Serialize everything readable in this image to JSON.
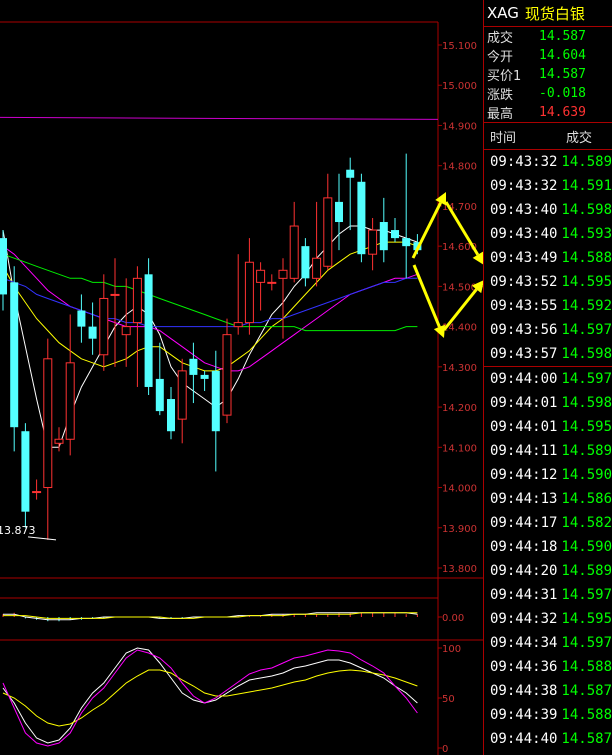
{
  "quote": {
    "code": "XAG",
    "name": "现货白银",
    "rows": [
      {
        "label": "成交",
        "value": "14.587",
        "color": "#00ff00"
      },
      {
        "label": "今开",
        "value": "14.604",
        "color": "#00ff00"
      },
      {
        "label": "买价1",
        "value": "14.587",
        "color": "#00ff00"
      },
      {
        "label": "涨跌",
        "value": "-0.018",
        "color": "#00ff00"
      },
      {
        "label": "最高",
        "value": "14.639",
        "color": "#ff3232"
      }
    ]
  },
  "trades": {
    "header_time": "时间",
    "header_price": "成交",
    "items": [
      {
        "time": "09:43:32",
        "price": "14.589"
      },
      {
        "time": "09:43:32",
        "price": "14.591"
      },
      {
        "time": "09:43:40",
        "price": "14.598"
      },
      {
        "time": "09:43:40",
        "price": "14.593"
      },
      {
        "time": "09:43:49",
        "price": "14.588"
      },
      {
        "time": "09:43:52",
        "price": "14.595"
      },
      {
        "time": "09:43:55",
        "price": "14.592"
      },
      {
        "time": "09:43:56",
        "price": "14.597"
      },
      {
        "time": "09:43:57",
        "price": "14.598"
      },
      {
        "time": "09:44:00",
        "price": "14.597"
      },
      {
        "time": "09:44:01",
        "price": "14.598"
      },
      {
        "time": "09:44:01",
        "price": "14.595"
      },
      {
        "time": "09:44:11",
        "price": "14.589"
      },
      {
        "time": "09:44:12",
        "price": "14.590"
      },
      {
        "time": "09:44:13",
        "price": "14.586"
      },
      {
        "time": "09:44:17",
        "price": "14.582"
      },
      {
        "time": "09:44:18",
        "price": "14.590"
      },
      {
        "time": "09:44:20",
        "price": "14.589"
      },
      {
        "time": "09:44:31",
        "price": "14.597"
      },
      {
        "time": "09:44:32",
        "price": "14.595"
      },
      {
        "time": "09:44:34",
        "price": "14.597"
      },
      {
        "time": "09:44:36",
        "price": "14.588"
      },
      {
        "time": "09:44:38",
        "price": "14.587"
      },
      {
        "time": "09:44:39",
        "price": "14.588"
      },
      {
        "time": "09:44:40",
        "price": "14.587"
      }
    ]
  },
  "chart_data": {
    "type": "candlestick",
    "price_axis": {
      "min": 13.8,
      "max": 15.1,
      "ticks": [
        "15.100",
        "15.000",
        "14.900",
        "14.800",
        "14.700",
        "14.600",
        "14.500",
        "14.400",
        "14.300",
        "14.200",
        "14.100",
        "14.000",
        "13.900",
        "13.800"
      ]
    },
    "low_annotation": "13.873",
    "candles": [
      {
        "o": 14.62,
        "h": 14.64,
        "l": 14.44,
        "c": 14.48
      },
      {
        "o": 14.51,
        "h": 14.55,
        "l": 14.09,
        "c": 14.15
      },
      {
        "o": 14.14,
        "h": 14.16,
        "l": 13.9,
        "c": 13.94
      },
      {
        "o": 13.99,
        "h": 14.02,
        "l": 13.97,
        "c": 13.99
      },
      {
        "o": 14.0,
        "h": 14.37,
        "l": 13.87,
        "c": 14.32
      },
      {
        "o": 14.11,
        "h": 14.15,
        "l": 14.09,
        "c": 14.12
      },
      {
        "o": 14.12,
        "h": 14.43,
        "l": 14.08,
        "c": 14.31
      },
      {
        "o": 14.44,
        "h": 14.48,
        "l": 14.36,
        "c": 14.4
      },
      {
        "o": 14.4,
        "h": 14.46,
        "l": 14.33,
        "c": 14.37
      },
      {
        "o": 14.33,
        "h": 14.53,
        "l": 14.29,
        "c": 14.47
      },
      {
        "o": 14.48,
        "h": 14.57,
        "l": 14.3,
        "c": 14.48
      },
      {
        "o": 14.38,
        "h": 14.52,
        "l": 14.3,
        "c": 14.4
      },
      {
        "o": 14.41,
        "h": 14.55,
        "l": 14.25,
        "c": 14.52
      },
      {
        "o": 14.53,
        "h": 14.57,
        "l": 14.23,
        "c": 14.25
      },
      {
        "o": 14.27,
        "h": 14.36,
        "l": 14.18,
        "c": 14.19
      },
      {
        "o": 14.22,
        "h": 14.25,
        "l": 14.12,
        "c": 14.14
      },
      {
        "o": 14.17,
        "h": 14.32,
        "l": 14.11,
        "c": 14.29
      },
      {
        "o": 14.32,
        "h": 14.36,
        "l": 14.21,
        "c": 14.28
      },
      {
        "o": 14.28,
        "h": 14.29,
        "l": 14.24,
        "c": 14.27
      },
      {
        "o": 14.29,
        "h": 14.34,
        "l": 14.04,
        "c": 14.14
      },
      {
        "o": 14.18,
        "h": 14.42,
        "l": 14.16,
        "c": 14.38
      },
      {
        "o": 14.4,
        "h": 14.58,
        "l": 14.38,
        "c": 14.41
      },
      {
        "o": 14.41,
        "h": 14.62,
        "l": 14.38,
        "c": 14.56
      },
      {
        "o": 14.51,
        "h": 14.56,
        "l": 14.44,
        "c": 14.54
      },
      {
        "o": 14.51,
        "h": 14.53,
        "l": 14.49,
        "c": 14.51
      },
      {
        "o": 14.52,
        "h": 14.57,
        "l": 14.37,
        "c": 14.54
      },
      {
        "o": 14.52,
        "h": 14.71,
        "l": 14.51,
        "c": 14.65
      },
      {
        "o": 14.6,
        "h": 14.62,
        "l": 14.5,
        "c": 14.52
      },
      {
        "o": 14.52,
        "h": 14.71,
        "l": 14.5,
        "c": 14.57
      },
      {
        "o": 14.55,
        "h": 14.78,
        "l": 14.54,
        "c": 14.72
      },
      {
        "o": 14.71,
        "h": 14.78,
        "l": 14.59,
        "c": 14.66
      },
      {
        "o": 14.79,
        "h": 14.82,
        "l": 14.64,
        "c": 14.77
      },
      {
        "o": 14.76,
        "h": 14.78,
        "l": 14.56,
        "c": 14.58
      },
      {
        "o": 14.58,
        "h": 14.67,
        "l": 14.54,
        "c": 14.64
      },
      {
        "o": 14.66,
        "h": 14.72,
        "l": 14.56,
        "c": 14.59
      },
      {
        "o": 14.64,
        "h": 14.67,
        "l": 14.61,
        "c": 14.62
      },
      {
        "o": 14.62,
        "h": 14.83,
        "l": 14.52,
        "c": 14.6
      },
      {
        "o": 14.61,
        "h": 14.63,
        "l": 14.58,
        "c": 14.59
      }
    ],
    "ma_lines": [
      {
        "color": "#ffffff",
        "values": [
          14.64,
          14.48,
          14.35,
          14.22,
          14.1,
          14.1,
          14.18,
          14.25,
          14.3,
          14.35,
          14.4,
          14.43,
          14.45,
          14.43,
          14.38,
          14.3,
          14.26,
          14.24,
          14.22,
          14.2,
          14.22,
          14.27,
          14.33,
          14.38,
          14.43,
          14.46,
          14.5,
          14.53,
          14.57,
          14.6,
          14.63,
          14.65,
          14.65,
          14.64,
          14.64,
          14.63,
          14.62,
          14.61
        ]
      },
      {
        "color": "#ffff00",
        "values": [
          14.55,
          14.5,
          14.46,
          14.42,
          14.39,
          14.36,
          14.34,
          14.32,
          14.31,
          14.3,
          14.31,
          14.32,
          14.34,
          14.35,
          14.35,
          14.33,
          14.31,
          14.3,
          14.29,
          14.29,
          14.3,
          14.32,
          14.34,
          14.37,
          14.4,
          14.42,
          14.45,
          14.48,
          14.51,
          14.54,
          14.56,
          14.58,
          14.59,
          14.6,
          14.61,
          14.61,
          14.61,
          14.6
        ]
      },
      {
        "color": "#ff00ff",
        "values": [
          14.6,
          14.58,
          14.55,
          14.52,
          14.49,
          14.47,
          14.45,
          14.44,
          14.43,
          14.42,
          14.41,
          14.4,
          14.4,
          14.4,
          14.39,
          14.37,
          14.35,
          14.33,
          14.31,
          14.3,
          14.29,
          14.29,
          14.3,
          14.32,
          14.34,
          14.36,
          14.38,
          14.4,
          14.42,
          14.44,
          14.46,
          14.48,
          14.49,
          14.5,
          14.51,
          14.52,
          14.52,
          14.53
        ]
      },
      {
        "color": "#3333ff",
        "values": [
          14.52,
          14.51,
          14.5,
          14.48,
          14.47,
          14.46,
          14.45,
          14.44,
          14.43,
          14.42,
          14.42,
          14.41,
          14.41,
          14.4,
          14.4,
          14.4,
          14.4,
          14.4,
          14.4,
          14.4,
          14.4,
          14.4,
          14.41,
          14.41,
          14.42,
          14.42,
          14.43,
          14.44,
          14.45,
          14.46,
          14.47,
          14.48,
          14.49,
          14.5,
          14.51,
          14.51,
          14.52,
          14.52
        ]
      },
      {
        "color": "#00ee00",
        "values": [
          14.58,
          14.57,
          14.56,
          14.55,
          14.54,
          14.53,
          14.52,
          14.52,
          14.51,
          14.51,
          14.5,
          14.5,
          14.49,
          14.48,
          14.47,
          14.46,
          14.45,
          14.44,
          14.43,
          14.42,
          14.41,
          14.4,
          14.4,
          14.4,
          14.4,
          14.4,
          14.4,
          14.39,
          14.39,
          14.39,
          14.39,
          14.39,
          14.39,
          14.39,
          14.39,
          14.39,
          14.4,
          14.4
        ]
      }
    ],
    "reference_line": {
      "value": 14.915,
      "color": "#cc00cc"
    },
    "macd": {
      "tick": "0.00",
      "bars": [
        0.02,
        0.03,
        -0.01,
        -0.02,
        -0.03,
        -0.03,
        -0.02,
        -0.02,
        -0.01,
        -0.01,
        0.0,
        0.0,
        0.0,
        0.0,
        -0.01,
        -0.01,
        -0.01,
        0.0,
        0.0,
        0.0,
        0.0,
        0.01,
        0.01,
        0.01,
        0.02,
        0.02,
        0.02,
        0.02,
        0.02,
        0.02,
        0.03,
        0.03,
        0.03,
        0.03,
        0.03,
        0.03,
        0.02,
        0.02
      ],
      "dif": [
        0.02,
        0.02,
        0.0,
        -0.01,
        -0.02,
        -0.02,
        -0.02,
        -0.01,
        -0.01,
        0.0,
        0.0,
        0.0,
        0.0,
        0.0,
        -0.01,
        -0.01,
        -0.01,
        0.0,
        0.0,
        0.0,
        0.0,
        0.01,
        0.01,
        0.01,
        0.02,
        0.02,
        0.02,
        0.02,
        0.03,
        0.03,
        0.03,
        0.03,
        0.03,
        0.03,
        0.03,
        0.03,
        0.03,
        0.02
      ],
      "dea": [
        0.01,
        0.01,
        0.01,
        0.0,
        -0.01,
        -0.01,
        -0.01,
        -0.01,
        -0.01,
        -0.01,
        0.0,
        0.0,
        0.0,
        0.0,
        0.0,
        -0.01,
        -0.01,
        -0.01,
        0.0,
        0.0,
        0.0,
        0.0,
        0.01,
        0.01,
        0.01,
        0.01,
        0.02,
        0.02,
        0.02,
        0.02,
        0.02,
        0.02,
        0.03,
        0.03,
        0.03,
        0.03,
        0.03,
        0.03
      ]
    },
    "kdj": {
      "ticks": [
        "100",
        "50",
        "0"
      ],
      "k": [
        60,
        45,
        25,
        10,
        5,
        8,
        20,
        40,
        55,
        65,
        80,
        95,
        100,
        98,
        85,
        70,
        55,
        48,
        45,
        48,
        55,
        62,
        68,
        70,
        72,
        75,
        80,
        82,
        85,
        88,
        88,
        85,
        80,
        75,
        70,
        62,
        55,
        45
      ],
      "d": [
        55,
        50,
        42,
        32,
        25,
        22,
        24,
        30,
        38,
        45,
        55,
        65,
        72,
        78,
        78,
        75,
        68,
        62,
        55,
        52,
        52,
        54,
        56,
        58,
        60,
        63,
        66,
        68,
        72,
        75,
        77,
        78,
        77,
        75,
        73,
        70,
        66,
        62
      ],
      "j": [
        65,
        40,
        15,
        5,
        2,
        5,
        15,
        35,
        50,
        60,
        75,
        90,
        98,
        95,
        90,
        80,
        65,
        52,
        45,
        50,
        58,
        66,
        74,
        78,
        80,
        85,
        90,
        92,
        95,
        98,
        97,
        95,
        88,
        82,
        75,
        62,
        50,
        35
      ]
    }
  }
}
